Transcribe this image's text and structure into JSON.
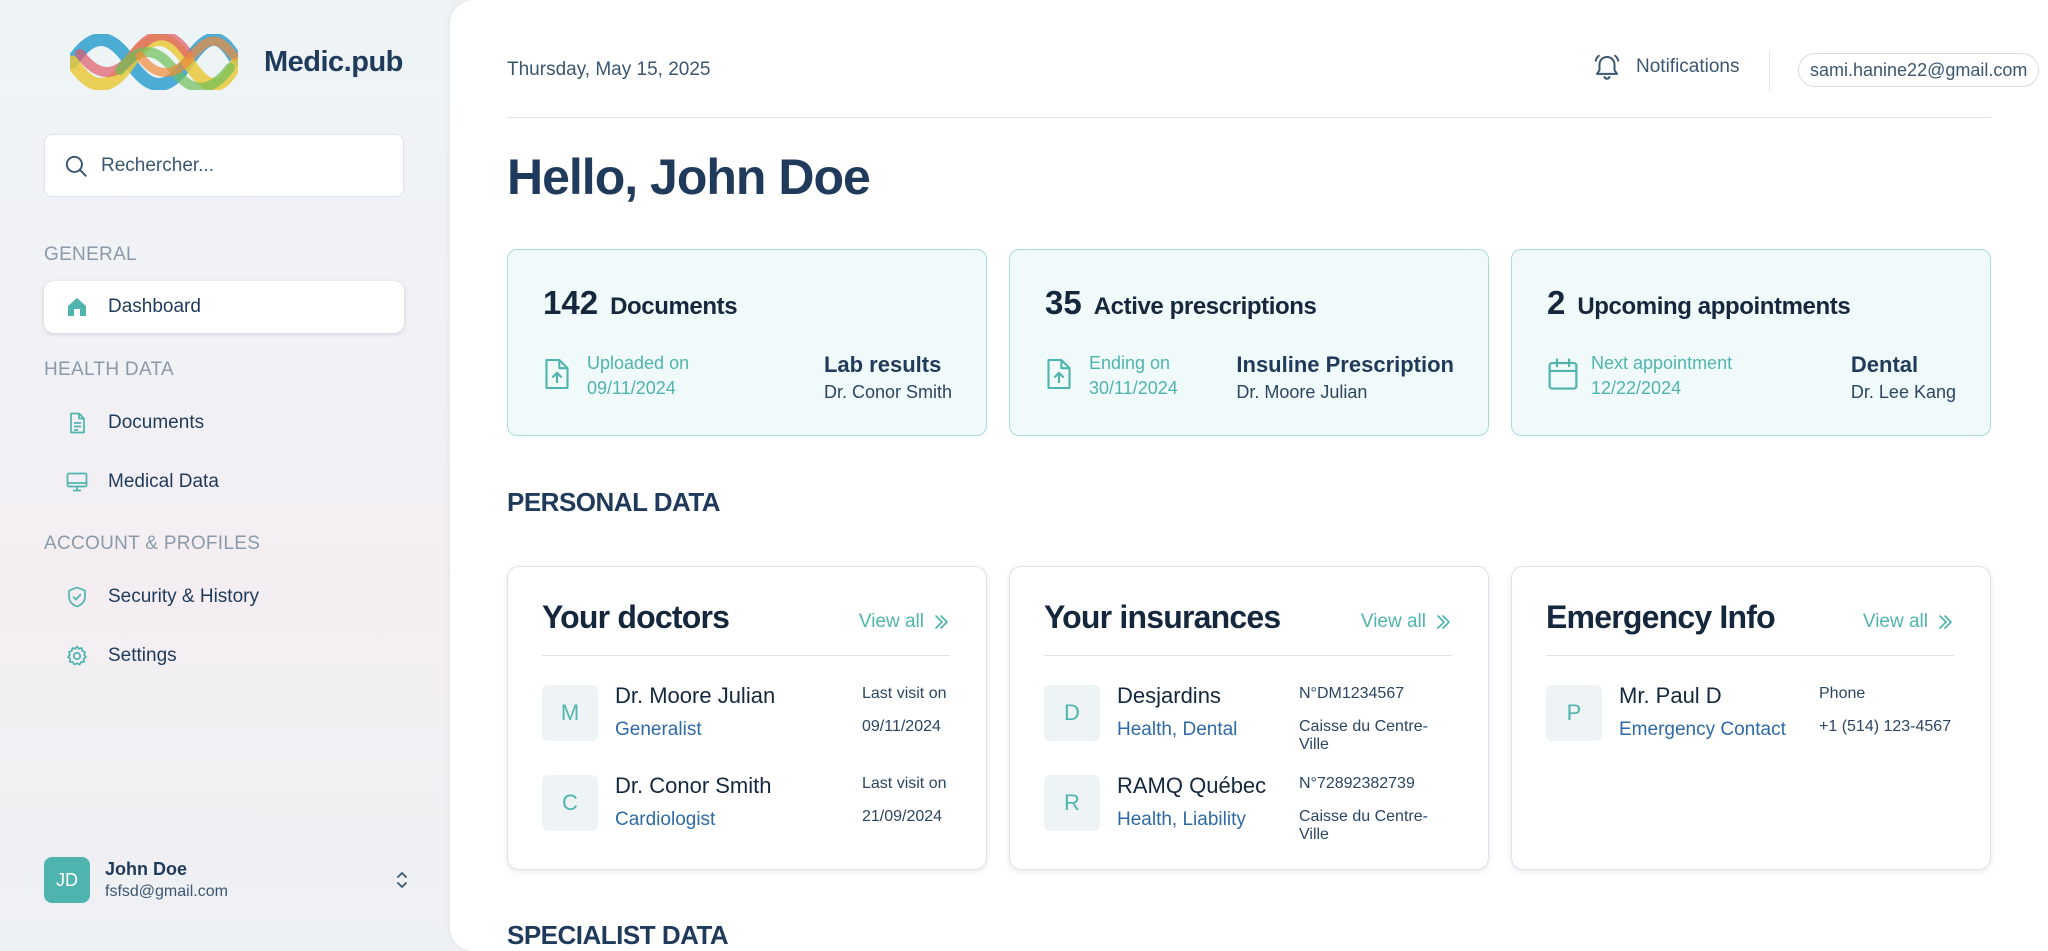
{
  "brand": {
    "name": "Medic.pub"
  },
  "search": {
    "placeholder": "Rechercher..."
  },
  "sidebar": {
    "sections": [
      "GENERAL",
      "HEALTH DATA",
      "ACCOUNT & PROFILES"
    ],
    "items": [
      {
        "label": "Dashboard",
        "icon": "home-icon"
      },
      {
        "label": "Documents",
        "icon": "document-icon"
      },
      {
        "label": "Medical Data",
        "icon": "monitor-icon"
      },
      {
        "label": "Security & History",
        "icon": "shield-icon"
      },
      {
        "label": "Settings",
        "icon": "gear-icon"
      }
    ]
  },
  "user": {
    "initials": "JD",
    "name": "John Doe",
    "email": "fsfsd@gmail.com"
  },
  "header": {
    "date": "Thursday, May 15, 2025",
    "notifications_label": "Notifications",
    "account_email": "sami.hanine22@gmail.com"
  },
  "greeting": "Hello, John Doe",
  "stats": [
    {
      "count": "142",
      "label": "Documents",
      "sub_label": "Uploaded on",
      "sub_value": "09/11/2024",
      "title": "Lab results",
      "detail": "Dr. Conor Smith",
      "icon": "file-upload-icon"
    },
    {
      "count": "35",
      "label": "Active prescriptions",
      "sub_label": "Ending on",
      "sub_value": "30/11/2024",
      "title": "Insuline Prescription",
      "detail": "Dr. Moore Julian",
      "icon": "file-upload-icon"
    },
    {
      "count": "2",
      "label": "Upcoming appointments",
      "sub_label": "Next appointment",
      "sub_value": "12/22/2024",
      "title": "Dental",
      "detail": "Dr. Lee Kang",
      "icon": "calendar-icon"
    }
  ],
  "sections": {
    "personal": "PERSONAL DATA",
    "specialist": "SPECIALIST DATA"
  },
  "cards": {
    "view_all": "View all",
    "doctors": {
      "title": "Your doctors",
      "rows": [
        {
          "initial": "M",
          "name": "Dr. Moore Julian",
          "sub": "Generalist",
          "meta1": "Last visit on",
          "meta2": "09/11/2024"
        },
        {
          "initial": "C",
          "name": "Dr. Conor Smith",
          "sub": "Cardiologist",
          "meta1": "Last visit on",
          "meta2": "21/09/2024"
        }
      ]
    },
    "insurances": {
      "title": "Your insurances",
      "rows": [
        {
          "initial": "D",
          "name": "Desjardins",
          "sub": "Health, Dental",
          "meta1": "N°DM1234567",
          "meta2": "Caisse du Centre-Ville"
        },
        {
          "initial": "R",
          "name": "RAMQ Québec",
          "sub": "Health, Liability",
          "meta1": "N°72892382739",
          "meta2": "Caisse du Centre-Ville"
        }
      ]
    },
    "emergency": {
      "title": "Emergency Info",
      "rows": [
        {
          "initial": "P",
          "name": "Mr. Paul D",
          "sub": "Emergency Contact",
          "meta1": "Phone",
          "meta2": "+1 (514) 123-4567"
        }
      ]
    }
  },
  "colors": {
    "accent": "#4fb4ae",
    "navy": "#1f3a5a",
    "card_bg": "#f1fafa",
    "card_border": "#a9dcd8"
  }
}
